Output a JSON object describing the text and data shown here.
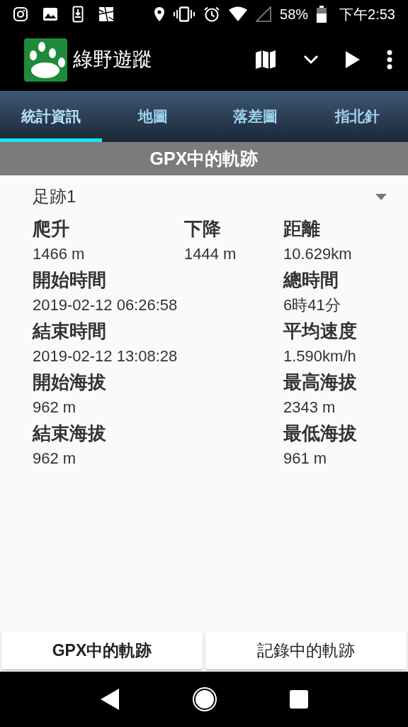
{
  "status_bar": {
    "battery": "58%",
    "time": "下午2:53"
  },
  "app_bar": {
    "title": "綠野遊蹤"
  },
  "tabs": [
    {
      "label": "統計資訊",
      "selected": true
    },
    {
      "label": "地圖",
      "selected": false
    },
    {
      "label": "落差圖",
      "selected": false
    },
    {
      "label": "指北針",
      "selected": false
    }
  ],
  "section_header": "GPX中的軌跡",
  "track_select": {
    "value": "足跡1"
  },
  "stats": [
    {
      "left": {
        "label": "爬升",
        "value": "1466 m"
      },
      "middle": {
        "label": "下降",
        "value": "1444 m"
      },
      "right": {
        "label": "距離",
        "value": "10.629km"
      }
    },
    {
      "left": {
        "label": "開始時間",
        "value": "2019-02-12 06:26:58"
      },
      "right": {
        "label": "總時間",
        "value": "6時41分"
      }
    },
    {
      "left": {
        "label": "結束時間",
        "value": "2019-02-12 13:08:28"
      },
      "right": {
        "label": "平均速度",
        "value": "1.590km/h"
      }
    },
    {
      "left": {
        "label": "開始海拔",
        "value": "962 m"
      },
      "right": {
        "label": "最高海拔",
        "value": "2343 m"
      }
    },
    {
      "left": {
        "label": "結束海拔",
        "value": "962 m"
      },
      "right": {
        "label": "最低海拔",
        "value": "961 m"
      }
    }
  ],
  "bottom_buttons": [
    {
      "label": "GPX中的軌跡",
      "selected": true
    },
    {
      "label": "記錄中的軌跡",
      "selected": false
    }
  ]
}
